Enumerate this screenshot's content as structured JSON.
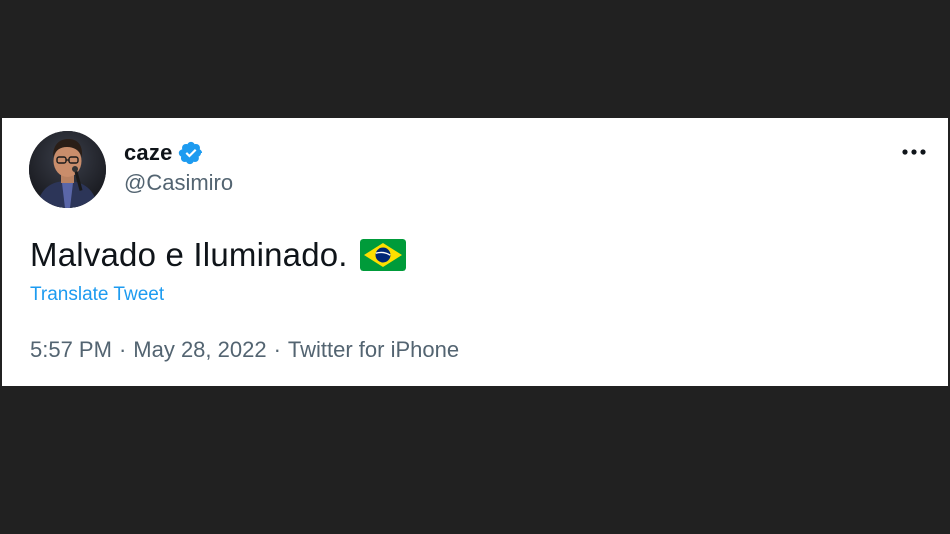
{
  "tweet": {
    "display_name": "caze",
    "handle": "@Casimiro",
    "text": "Malvado e Iluminado.",
    "translate_label": "Translate Tweet",
    "time": "5:57 PM",
    "separator": "·",
    "date": "May 28, 2022",
    "source": "Twitter for iPhone",
    "icons": {
      "verified": "verified-badge-icon",
      "flag": "brazil-flag-emoji",
      "more": "more-options-icon"
    }
  },
  "colors": {
    "background": "#212121",
    "card": "#ffffff",
    "text_primary": "#0f1419",
    "text_secondary": "#536471",
    "link": "#1d9bf0",
    "verified": "#1d9bf0"
  }
}
